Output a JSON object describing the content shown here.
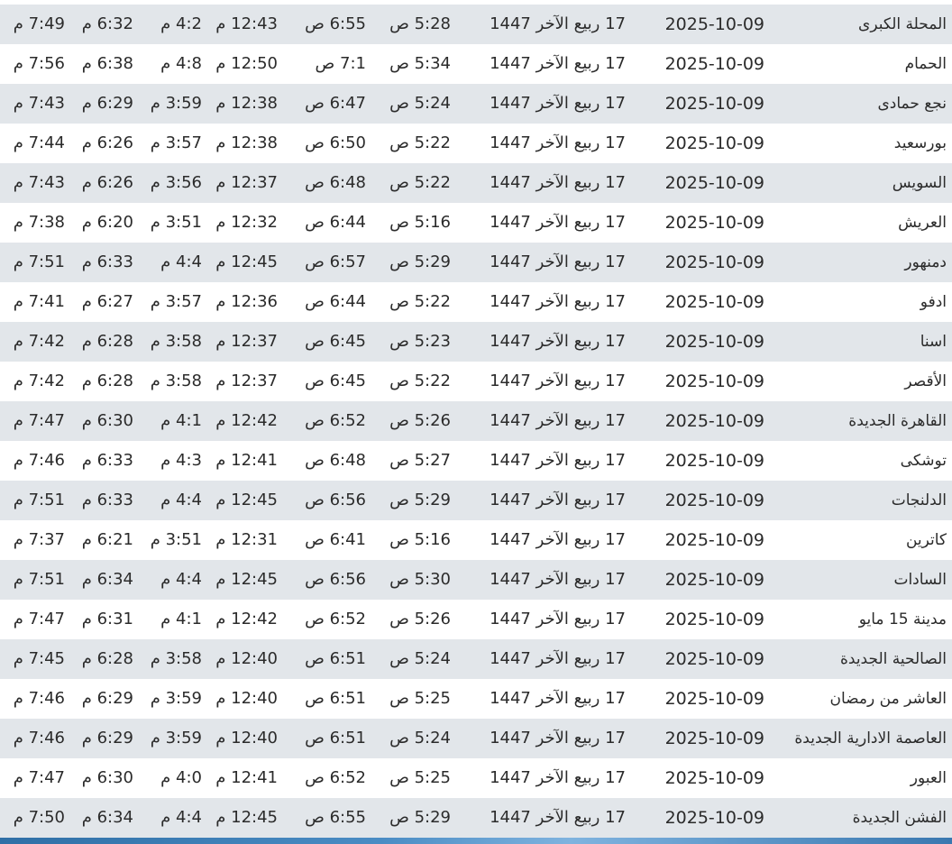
{
  "table": {
    "rows": [
      {
        "city": "المحلة الكبرى",
        "date": "2025-10-09",
        "hijri": "17 ربيع الآخر 1447",
        "fajr": "5:28 ص",
        "sunrise": "6:55 ص",
        "dhuhr": "12:43 م",
        "asr": "4:2 م",
        "maghrib": "6:32 م",
        "isha": "7:49 م"
      },
      {
        "city": "الحمام",
        "date": "2025-10-09",
        "hijri": "17 ربيع الآخر 1447",
        "fajr": "5:34 ص",
        "sunrise": "7:1 ص",
        "dhuhr": "12:50 م",
        "asr": "4:8 م",
        "maghrib": "6:38 م",
        "isha": "7:56 م"
      },
      {
        "city": "نجع حمادى",
        "date": "2025-10-09",
        "hijri": "17 ربيع الآخر 1447",
        "fajr": "5:24 ص",
        "sunrise": "6:47 ص",
        "dhuhr": "12:38 م",
        "asr": "3:59 م",
        "maghrib": "6:29 م",
        "isha": "7:43 م"
      },
      {
        "city": "بورسعيد",
        "date": "2025-10-09",
        "hijri": "17 ربيع الآخر 1447",
        "fajr": "5:22 ص",
        "sunrise": "6:50 ص",
        "dhuhr": "12:38 م",
        "asr": "3:57 م",
        "maghrib": "6:26 م",
        "isha": "7:44 م"
      },
      {
        "city": "السويس",
        "date": "2025-10-09",
        "hijri": "17 ربيع الآخر 1447",
        "fajr": "5:22 ص",
        "sunrise": "6:48 ص",
        "dhuhr": "12:37 م",
        "asr": "3:56 م",
        "maghrib": "6:26 م",
        "isha": "7:43 م"
      },
      {
        "city": "العريش",
        "date": "2025-10-09",
        "hijri": "17 ربيع الآخر 1447",
        "fajr": "5:16 ص",
        "sunrise": "6:44 ص",
        "dhuhr": "12:32 م",
        "asr": "3:51 م",
        "maghrib": "6:20 م",
        "isha": "7:38 م"
      },
      {
        "city": "دمنهور",
        "date": "2025-10-09",
        "hijri": "17 ربيع الآخر 1447",
        "fajr": "5:29 ص",
        "sunrise": "6:57 ص",
        "dhuhr": "12:45 م",
        "asr": "4:4 م",
        "maghrib": "6:33 م",
        "isha": "7:51 م"
      },
      {
        "city": "ادفو",
        "date": "2025-10-09",
        "hijri": "17 ربيع الآخر 1447",
        "fajr": "5:22 ص",
        "sunrise": "6:44 ص",
        "dhuhr": "12:36 م",
        "asr": "3:57 م",
        "maghrib": "6:27 م",
        "isha": "7:41 م"
      },
      {
        "city": "اسنا",
        "date": "2025-10-09",
        "hijri": "17 ربيع الآخر 1447",
        "fajr": "5:23 ص",
        "sunrise": "6:45 ص",
        "dhuhr": "12:37 م",
        "asr": "3:58 م",
        "maghrib": "6:28 م",
        "isha": "7:42 م"
      },
      {
        "city": "الأقصر",
        "date": "2025-10-09",
        "hijri": "17 ربيع الآخر 1447",
        "fajr": "5:22 ص",
        "sunrise": "6:45 ص",
        "dhuhr": "12:37 م",
        "asr": "3:58 م",
        "maghrib": "6:28 م",
        "isha": "7:42 م"
      },
      {
        "city": "القاهرة الجديدة",
        "date": "2025-10-09",
        "hijri": "17 ربيع الآخر 1447",
        "fajr": "5:26 ص",
        "sunrise": "6:52 ص",
        "dhuhr": "12:42 م",
        "asr": "4:1 م",
        "maghrib": "6:30 م",
        "isha": "7:47 م"
      },
      {
        "city": "توشكى",
        "date": "2025-10-09",
        "hijri": "17 ربيع الآخر 1447",
        "fajr": "5:27 ص",
        "sunrise": "6:48 ص",
        "dhuhr": "12:41 م",
        "asr": "4:3 م",
        "maghrib": "6:33 م",
        "isha": "7:46 م"
      },
      {
        "city": "الدلنجات",
        "date": "2025-10-09",
        "hijri": "17 ربيع الآخر 1447",
        "fajr": "5:29 ص",
        "sunrise": "6:56 ص",
        "dhuhr": "12:45 م",
        "asr": "4:4 م",
        "maghrib": "6:33 م",
        "isha": "7:51 م"
      },
      {
        "city": "كاترين",
        "date": "2025-10-09",
        "hijri": "17 ربيع الآخر 1447",
        "fajr": "5:16 ص",
        "sunrise": "6:41 ص",
        "dhuhr": "12:31 م",
        "asr": "3:51 م",
        "maghrib": "6:21 م",
        "isha": "7:37 م"
      },
      {
        "city": "السادات",
        "date": "2025-10-09",
        "hijri": "17 ربيع الآخر 1447",
        "fajr": "5:30 ص",
        "sunrise": "6:56 ص",
        "dhuhr": "12:45 م",
        "asr": "4:4 م",
        "maghrib": "6:34 م",
        "isha": "7:51 م"
      },
      {
        "city": "مدينة 15 مايو",
        "date": "2025-10-09",
        "hijri": "17 ربيع الآخر 1447",
        "fajr": "5:26 ص",
        "sunrise": "6:52 ص",
        "dhuhr": "12:42 م",
        "asr": "4:1 م",
        "maghrib": "6:31 م",
        "isha": "7:47 م"
      },
      {
        "city": "الصالحية الجديدة",
        "date": "2025-10-09",
        "hijri": "17 ربيع الآخر 1447",
        "fajr": "5:24 ص",
        "sunrise": "6:51 ص",
        "dhuhr": "12:40 م",
        "asr": "3:58 م",
        "maghrib": "6:28 م",
        "isha": "7:45 م"
      },
      {
        "city": "العاشر من رمضان",
        "date": "2025-10-09",
        "hijri": "17 ربيع الآخر 1447",
        "fajr": "5:25 ص",
        "sunrise": "6:51 ص",
        "dhuhr": "12:40 م",
        "asr": "3:59 م",
        "maghrib": "6:29 م",
        "isha": "7:46 م"
      },
      {
        "city": "العاصمة الادارية الجديدة",
        "date": "2025-10-09",
        "hijri": "17 ربيع الآخر 1447",
        "fajr": "5:24 ص",
        "sunrise": "6:51 ص",
        "dhuhr": "12:40 م",
        "asr": "3:59 م",
        "maghrib": "6:29 م",
        "isha": "7:46 م"
      },
      {
        "city": "العبور",
        "date": "2025-10-09",
        "hijri": "17 ربيع الآخر 1447",
        "fajr": "5:25 ص",
        "sunrise": "6:52 ص",
        "dhuhr": "12:41 م",
        "asr": "4:0 م",
        "maghrib": "6:30 م",
        "isha": "7:47 م"
      },
      {
        "city": "الفشن الجديدة",
        "date": "2025-10-09",
        "hijri": "17 ربيع الآخر 1447",
        "fajr": "5:29 ص",
        "sunrise": "6:55 ص",
        "dhuhr": "12:45 م",
        "asr": "4:4 م",
        "maghrib": "6:34 م",
        "isha": "7:50 م"
      }
    ]
  },
  "colors": {
    "stripe": "#e2e6ea",
    "text": "#2b2b2b",
    "bottom_bar": "#3a78b0"
  }
}
